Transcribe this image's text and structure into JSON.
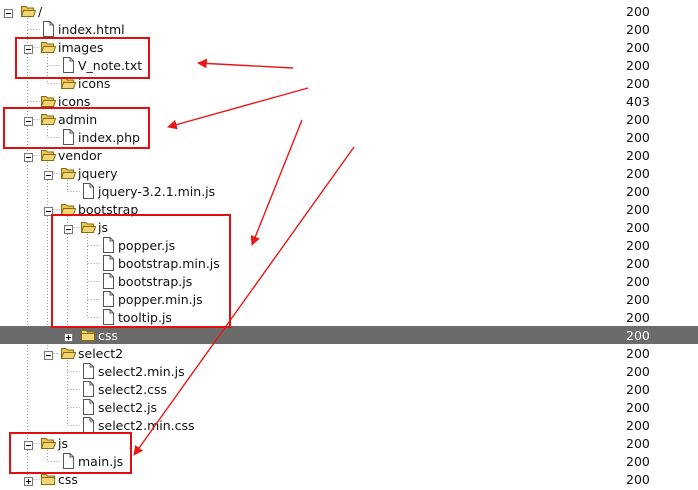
{
  "tree": {
    "rows": [
      {
        "label": "/",
        "status": "200",
        "depth": 0,
        "type": "folder-open",
        "toggle": "minus"
      },
      {
        "label": "index.html",
        "status": "200",
        "depth": 1,
        "type": "file"
      },
      {
        "label": "images",
        "status": "200",
        "depth": 1,
        "type": "folder-open",
        "toggle": "minus"
      },
      {
        "label": "V_note.txt",
        "status": "200",
        "depth": 2,
        "type": "file"
      },
      {
        "label": "icons",
        "status": "200",
        "depth": 2,
        "type": "folder-open"
      },
      {
        "label": "icons",
        "status": "403",
        "depth": 1,
        "type": "folder-open"
      },
      {
        "label": "admin",
        "status": "200",
        "depth": 1,
        "type": "folder-open",
        "toggle": "minus"
      },
      {
        "label": "index.php",
        "status": "200",
        "depth": 2,
        "type": "file"
      },
      {
        "label": "vendor",
        "status": "200",
        "depth": 1,
        "type": "folder-open",
        "toggle": "minus"
      },
      {
        "label": "jquery",
        "status": "200",
        "depth": 2,
        "type": "folder-open",
        "toggle": "minus"
      },
      {
        "label": "jquery-3.2.1.min.js",
        "status": "200",
        "depth": 3,
        "type": "file"
      },
      {
        "label": "bootstrap",
        "status": "200",
        "depth": 2,
        "type": "folder-open",
        "toggle": "minus"
      },
      {
        "label": "js",
        "status": "200",
        "depth": 3,
        "type": "folder-open",
        "toggle": "minus"
      },
      {
        "label": "popper.js",
        "status": "200",
        "depth": 4,
        "type": "file"
      },
      {
        "label": "bootstrap.min.js",
        "status": "200",
        "depth": 4,
        "type": "file"
      },
      {
        "label": "bootstrap.js",
        "status": "200",
        "depth": 4,
        "type": "file"
      },
      {
        "label": "popper.min.js",
        "status": "200",
        "depth": 4,
        "type": "file"
      },
      {
        "label": "tooltip.js",
        "status": "200",
        "depth": 4,
        "type": "file"
      },
      {
        "label": "css",
        "status": "200",
        "depth": 3,
        "type": "folder-closed",
        "toggle": "plus",
        "selected": true
      },
      {
        "label": "select2",
        "status": "200",
        "depth": 2,
        "type": "folder-open",
        "toggle": "minus"
      },
      {
        "label": "select2.min.js",
        "status": "200",
        "depth": 3,
        "type": "file"
      },
      {
        "label": "select2.css",
        "status": "200",
        "depth": 3,
        "type": "file"
      },
      {
        "label": "select2.js",
        "status": "200",
        "depth": 3,
        "type": "file"
      },
      {
        "label": "select2.min.css",
        "status": "200",
        "depth": 3,
        "type": "file"
      },
      {
        "label": "js",
        "status": "200",
        "depth": 1,
        "type": "folder-open",
        "toggle": "minus"
      },
      {
        "label": "main.js",
        "status": "200",
        "depth": 2,
        "type": "file"
      },
      {
        "label": "css",
        "status": "200",
        "depth": 1,
        "type": "folder-closed",
        "toggle": "plus"
      }
    ]
  },
  "annotations": {
    "highlight_color": "#e01010",
    "arrow_color": "#e81818"
  },
  "colors": {
    "selected_row": "#6b6b6b",
    "folder_fill": "#f2d675",
    "folder_stroke": "#8a6a10",
    "tree_line": "#9a9a9a"
  }
}
